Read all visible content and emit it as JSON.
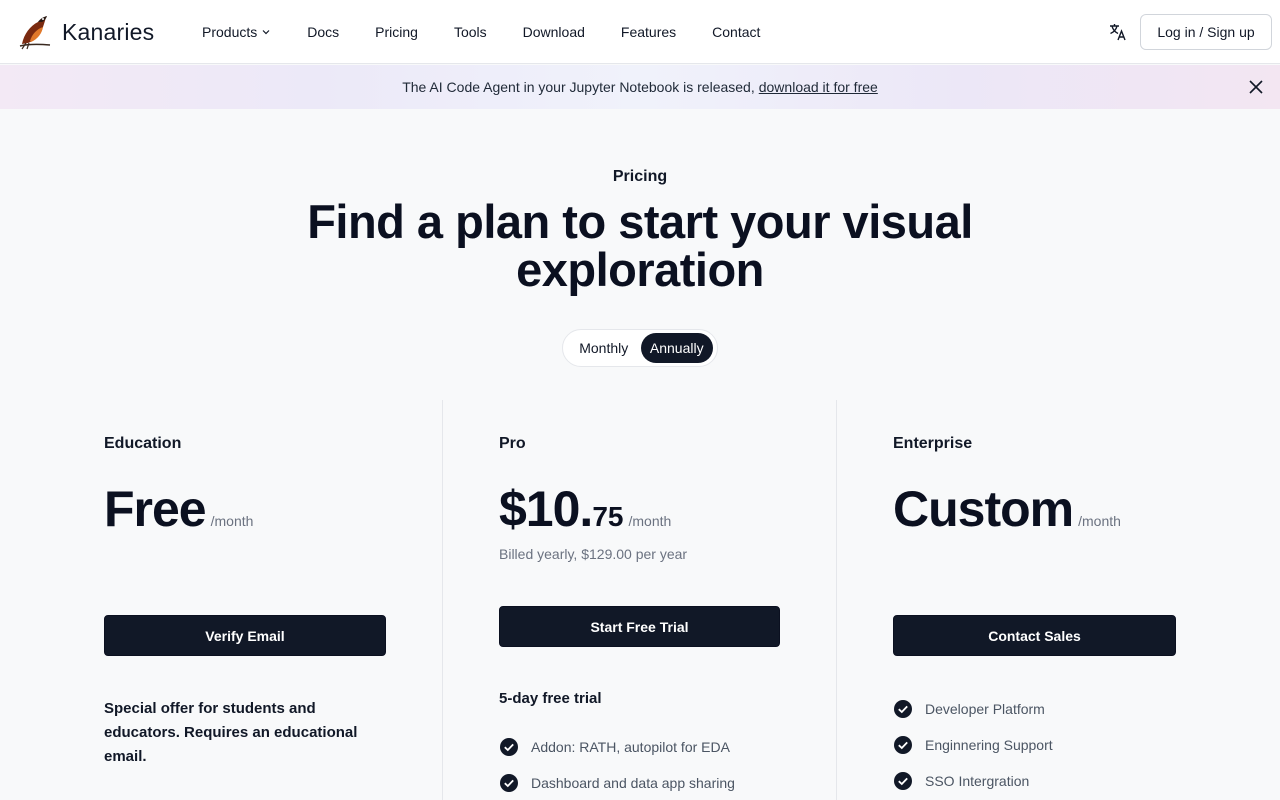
{
  "brand": {
    "name": "Kanaries",
    "logo_icon": "bird-logo-icon"
  },
  "nav": {
    "items": [
      {
        "label": "Products",
        "has_dropdown": true
      },
      {
        "label": "Docs"
      },
      {
        "label": "Pricing"
      },
      {
        "label": "Tools"
      },
      {
        "label": "Download"
      },
      {
        "label": "Features"
      },
      {
        "label": "Contact"
      }
    ],
    "language_icon": "translate-icon",
    "auth_label": "Log in / Sign up"
  },
  "banner": {
    "text": "The AI Code Agent in your Jupyter Notebook is released,",
    "link": "download it for free",
    "close_icon": "close-icon"
  },
  "hero": {
    "eyebrow": "Pricing",
    "title": "Find a plan to start your visual exploration"
  },
  "billing_toggle": {
    "options": [
      "Monthly",
      "Annually"
    ],
    "selected": "Annually"
  },
  "plans": [
    {
      "name": "Education",
      "price": "Free",
      "cents": "",
      "period": "/month",
      "billed": "",
      "cta": "Verify Email",
      "description": "Special offer for students and educators. Requires an educational email.",
      "features": []
    },
    {
      "name": "Pro",
      "price": "$10.",
      "cents": "75",
      "period": "/month",
      "billed": "Billed yearly, $129.00 per year",
      "cta": "Start Free Trial",
      "description": "5-day free trial",
      "features": [
        "Addon: RATH, autopilot for EDA",
        "Dashboard and data app sharing"
      ]
    },
    {
      "name": "Enterprise",
      "price": "Custom",
      "cents": "",
      "period": "/month",
      "billed": "",
      "cta": "Contact Sales",
      "description": "",
      "features": [
        "Developer Platform",
        "Enginnering Support",
        "SSO Intergration"
      ]
    }
  ],
  "colors": {
    "primary": "#111827",
    "background": "#f8f9fa",
    "muted_text": "#6b7280",
    "banner_gradient": [
      "#f3e9f5",
      "#ece9f8",
      "#f3e6f2"
    ]
  }
}
